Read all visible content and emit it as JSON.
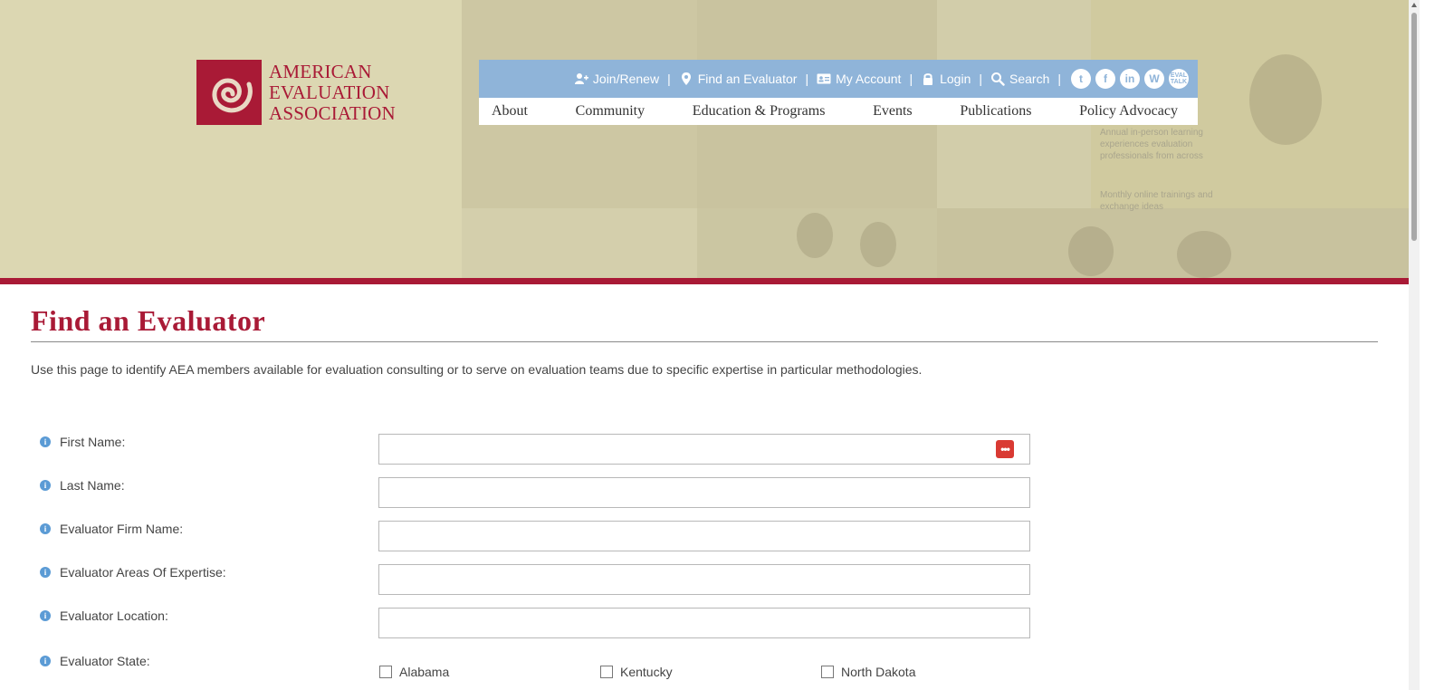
{
  "logo": {
    "lines": [
      "AMERICAN",
      "EVALUATION",
      "ASSOCIATION"
    ]
  },
  "utility_nav": [
    {
      "label": "Join/Renew",
      "icon": "user-plus-icon"
    },
    {
      "label": "Find an Evaluator",
      "icon": "map-pin-icon"
    },
    {
      "label": "My Account",
      "icon": "id-card-icon"
    },
    {
      "label": "Login",
      "icon": "lock-icon"
    },
    {
      "label": "Search",
      "icon": "search-icon"
    }
  ],
  "social": [
    {
      "icon": "twitter-icon",
      "glyph": "t"
    },
    {
      "icon": "facebook-icon",
      "glyph": "f"
    },
    {
      "icon": "linkedin-icon",
      "glyph": "in"
    },
    {
      "icon": "wordpress-icon",
      "glyph": "W"
    },
    {
      "icon": "evaltalk-icon",
      "glyph": "EVAL TALK"
    }
  ],
  "main_nav": [
    "About",
    "Community",
    "Education & Programs",
    "Events",
    "Publications",
    "Policy Advocacy"
  ],
  "banner_text": "Annual in-person learning experiences evaluation professionals from across",
  "banner_text2": "Monthly online trainings and exchange ideas",
  "page": {
    "title": "Find an Evaluator",
    "intro": "Use this page to identify AEA members available for evaluation consulting or to serve on evaluation teams due to specific expertise in particular methodologies."
  },
  "form": {
    "fields": [
      {
        "label": "First Name:",
        "value": ""
      },
      {
        "label": "Last Name:",
        "value": ""
      },
      {
        "label": "Evaluator Firm Name:",
        "value": ""
      },
      {
        "label": "Evaluator Areas Of Expertise:",
        "value": ""
      },
      {
        "label": "Evaluator Location:",
        "value": ""
      }
    ],
    "state_label": "Evaluator State:",
    "states": [
      "Alabama",
      "Kentucky",
      "North Dakota"
    ]
  },
  "colors": {
    "brand_red": "#a91a36",
    "nav_blue": "#8fb4d9",
    "banner_tan": "#dcd7b2",
    "info_blue": "#5b9bd5"
  }
}
